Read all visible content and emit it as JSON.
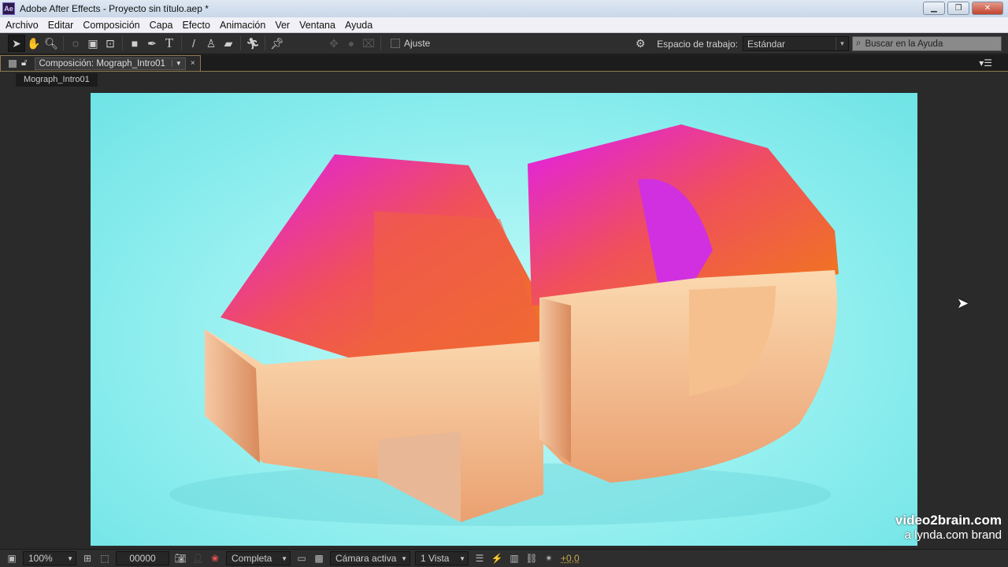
{
  "window": {
    "title": "Adobe After Effects - Proyecto sin título.aep *",
    "app_icon": "Ae"
  },
  "menu": [
    "Archivo",
    "Editar",
    "Composición",
    "Capa",
    "Efecto",
    "Animación",
    "Ver",
    "Ventana",
    "Ayuda"
  ],
  "toolbar": {
    "snap_label": "Ajuste",
    "workspace_label": "Espacio de trabajo:",
    "workspace_value": "Estándar",
    "search_placeholder": "Buscar en la Ayuda"
  },
  "panel": {
    "tab_label": "Composición: Mograph_Intro01",
    "breadcrumb": "Mograph_Intro01"
  },
  "watermark": {
    "line1": "video2brain.com",
    "line2": "a lynda.com brand"
  },
  "statusbar": {
    "zoom": "100%",
    "timecode": "00000",
    "resolution": "Completa",
    "camera": "Cámara activa",
    "views": "1 Vista",
    "exposure": "+0,0"
  },
  "colors": {
    "accent": "#c8a84a",
    "viewer_bg": "#8feeee"
  }
}
